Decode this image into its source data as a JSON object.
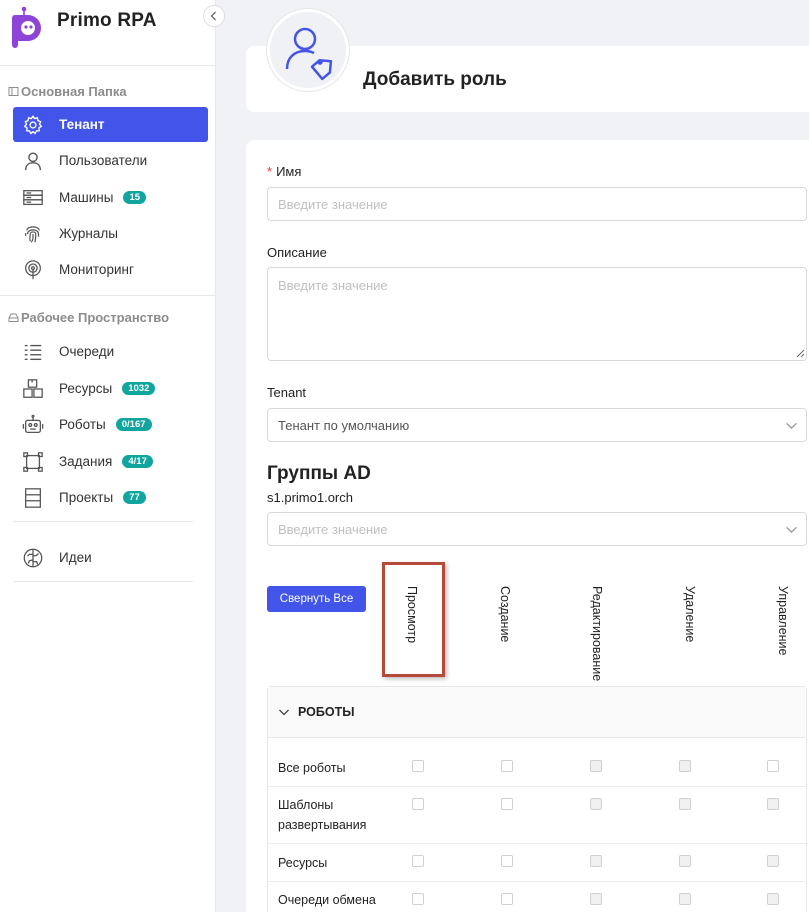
{
  "app": {
    "name": "Primo RPA"
  },
  "sidebar": {
    "section1": {
      "title": "Основная Папка"
    },
    "section1_items": [
      {
        "label": "Тенант",
        "active": true
      },
      {
        "label": "Пользователи"
      },
      {
        "label": "Машины",
        "badge": "15"
      },
      {
        "label": "Журналы"
      },
      {
        "label": "Мониторинг"
      }
    ],
    "section2": {
      "title": "Рабочее Пространство"
    },
    "section2_items": [
      {
        "label": "Очереди"
      },
      {
        "label": "Ресурсы",
        "badge": "1032"
      },
      {
        "label": "Роботы",
        "badge": "0/167"
      },
      {
        "label": "Задания",
        "badge": "4/17"
      },
      {
        "label": "Проекты",
        "badge": "77"
      }
    ],
    "extra_items": [
      {
        "label": "Идеи"
      }
    ]
  },
  "page": {
    "title": "Добавить роль"
  },
  "form": {
    "name_label": "Имя",
    "name_required": "*",
    "name_placeholder": "Введите значение",
    "description_label": "Описание",
    "description_placeholder": "Введите значение",
    "tenant_label": "Tenant",
    "tenant_value": "Тенант по умолчанию",
    "ad_groups_title": "Группы AD",
    "ad_groups_subtitle": "s1.primo1.orch",
    "ad_groups_placeholder": "Введите значение",
    "collapse_all_label": "Свернуть Все"
  },
  "permissions": {
    "columns": [
      "Просмотр",
      "Создание",
      "Редактирование",
      "Удаление",
      "Управление"
    ],
    "section_title": "РОБОТЫ",
    "rows": [
      {
        "name": "Все роботы",
        "disabled": [
          false,
          false,
          true,
          true,
          false
        ]
      },
      {
        "name": "Шаблоны развертывания",
        "disabled": [
          false,
          false,
          true,
          true,
          true
        ]
      },
      {
        "name": "Ресурсы",
        "disabled": [
          false,
          false,
          true,
          true,
          true
        ]
      },
      {
        "name": "Очереди обмена",
        "disabled": [
          false,
          false,
          true,
          true,
          true
        ]
      }
    ]
  },
  "colors": {
    "accent": "#4355e8",
    "badge": "#10a59e",
    "highlight": "#b5493a"
  }
}
